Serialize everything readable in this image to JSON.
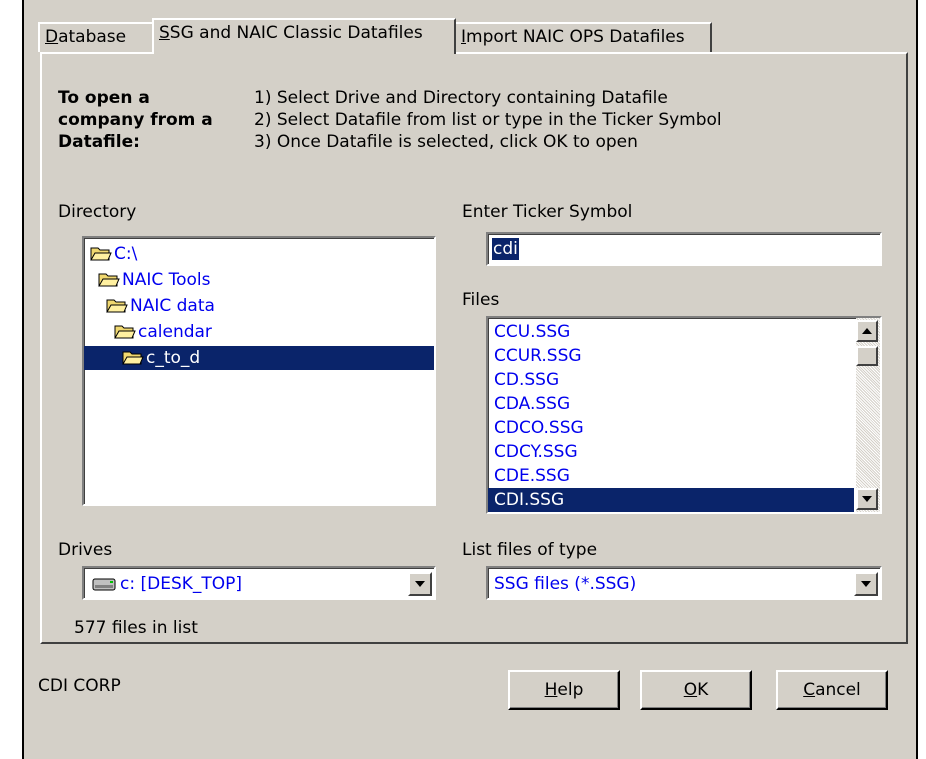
{
  "tabs": [
    {
      "label": "Database",
      "mnemonic": "D",
      "rest": "atabase"
    },
    {
      "label": "SSG and NAIC Classic Datafiles",
      "mnemonic": "S",
      "rest": "SG and NAIC Classic Datafiles"
    },
    {
      "label": "Import NAIC OPS Datafiles",
      "mnemonic": "I",
      "rest": "mport NAIC OPS Datafiles"
    }
  ],
  "instructions": {
    "heading_line1": "To open a",
    "heading_line2": "company from a",
    "heading_line3": "Datafile:",
    "step1": "1) Select Drive and Directory containing Datafile",
    "step2": "2) Select Datafile from list or type in the Ticker Symbol",
    "step3": "3) Once Datafile is selected, click OK to open"
  },
  "directory": {
    "label": "Directory",
    "items": [
      "C:\\",
      "NAIC Tools",
      "NAIC data",
      "calendar",
      "c_to_d"
    ],
    "selected_index": 4
  },
  "ticker": {
    "label": "Enter Ticker Symbol",
    "value": "cdi"
  },
  "files": {
    "label": "Files",
    "items": [
      "CCU.SSG",
      "CCUR.SSG",
      "CD.SSG",
      "CDA.SSG",
      "CDCO.SSG",
      "CDCY.SSG",
      "CDE.SSG",
      "CDI.SSG"
    ],
    "selected_index": 7
  },
  "drives": {
    "label": "Drives",
    "value": "c: [DESK_TOP]"
  },
  "filetype": {
    "label": "List files of type",
    "value": "SSG files (*.SSG)"
  },
  "file_count": "577 files in list",
  "company_name": "CDI CORP",
  "buttons": {
    "help": {
      "label": "Help",
      "mnemonic": "H",
      "rest": "elp"
    },
    "ok": {
      "label": "OK",
      "mnemonic": "O",
      "rest": "K"
    },
    "cancel": {
      "label": "Cancel",
      "mnemonic": "C",
      "rest": "ancel"
    }
  },
  "colors": {
    "face": "#d4d0c8",
    "selection": "#0a246a",
    "link_text": "#0000ee",
    "folder": "#f0d870"
  },
  "icons": {
    "folder": "folder-open-icon",
    "drive": "hard-drive-icon",
    "dropdown": "chevron-down-icon",
    "scroll_up": "arrow-up-icon",
    "scroll_down": "arrow-down-icon"
  }
}
